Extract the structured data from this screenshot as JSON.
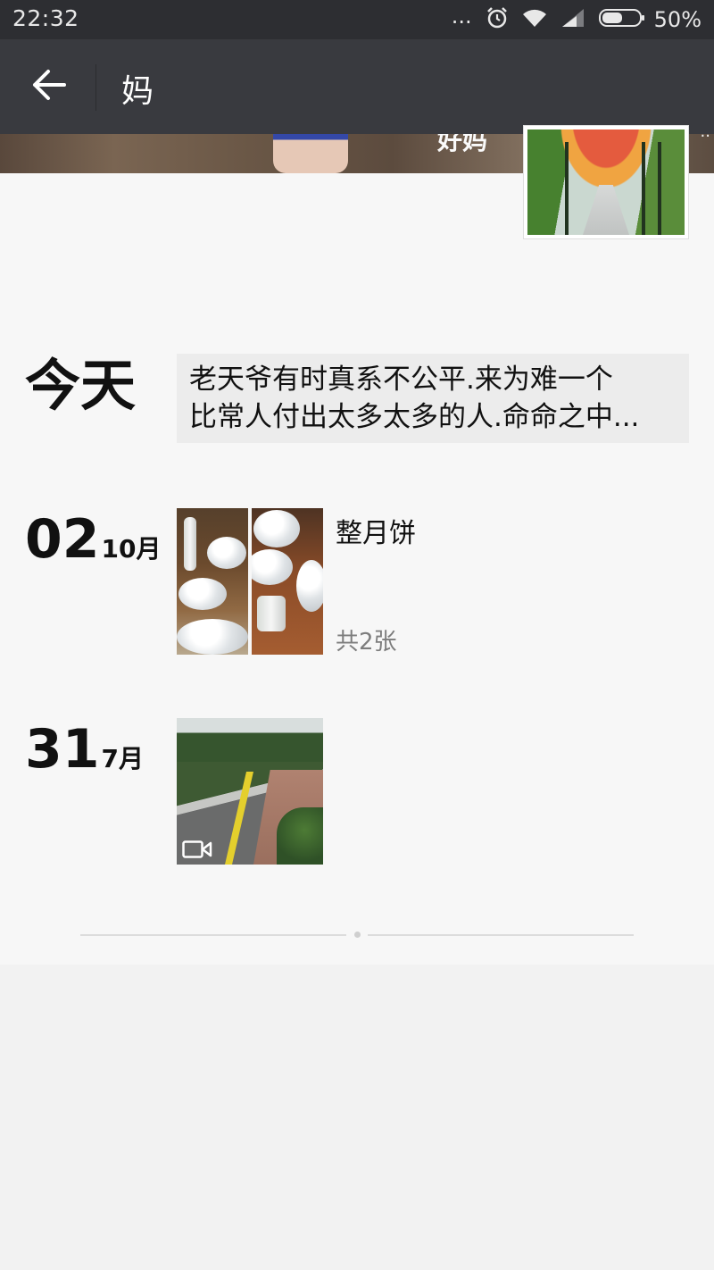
{
  "status_bar": {
    "time": "22:32",
    "more_indicator": "...",
    "battery": "50%",
    "icons": [
      "alarm-icon",
      "wifi-icon",
      "signal-icon",
      "battery-icon"
    ]
  },
  "app_bar": {
    "title": "妈",
    "back_icon": "arrow-left-icon"
  },
  "cover": {
    "caption": "好妈"
  },
  "timeline": {
    "today": {
      "label": "今天",
      "text_line_1": "老天爷有时真系不公平.来为难一个",
      "text_line_2": "比常人付出太多太多的人.命命之中..."
    },
    "posts": [
      {
        "day": "02",
        "month": "10月",
        "title": "整月饼",
        "count": "共2张"
      },
      {
        "day": "31",
        "month": "7月",
        "media_icon": "video-icon"
      }
    ]
  },
  "colors": {
    "status_bar": "#2d2e32",
    "app_bar": "#393a3f",
    "page_bg": "#f7f7f7",
    "text_card_bg": "#ececec",
    "secondary_text": "#7d7d7d"
  }
}
